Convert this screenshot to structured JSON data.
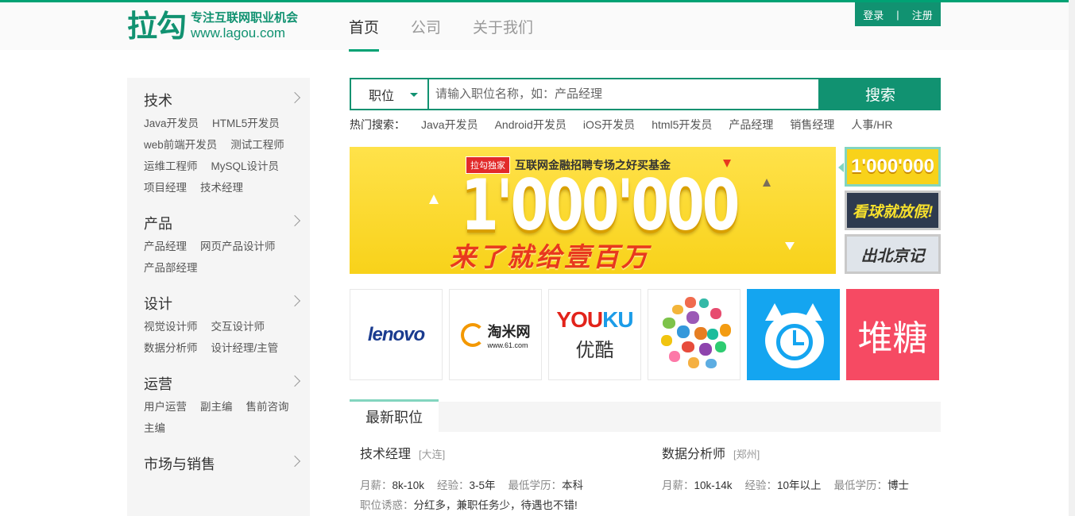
{
  "header": {
    "logo_text": "拉勾",
    "slogan": "专注互联网职业机会",
    "url": "www.lagou.com",
    "nav": [
      "首页",
      "公司",
      "关于我们"
    ],
    "login": "登录",
    "sep": "|",
    "register": "注册"
  },
  "sidebar": {
    "categories": [
      {
        "title": "技术",
        "links": [
          "Java开发员",
          "HTML5开发员",
          "web前端开发员",
          "测试工程师",
          "运维工程师",
          "MySQL设计员",
          "项目经理",
          "技术经理"
        ]
      },
      {
        "title": "产品",
        "links": [
          "产品经理",
          "网页产品设计师",
          "产品部经理"
        ]
      },
      {
        "title": "设计",
        "links": [
          "视觉设计师",
          "交互设计师",
          "数据分析师",
          "设计经理/主管"
        ]
      },
      {
        "title": "运营",
        "links": [
          "用户运营",
          "副主编",
          "售前咨询",
          "主编"
        ]
      },
      {
        "title": "市场与销售",
        "links": []
      }
    ]
  },
  "search": {
    "select_value": "职位",
    "placeholder": "请输入职位名称，如：产品经理",
    "button": "搜索",
    "hot_label": "热门搜索：",
    "hot_terms": [
      "Java开发员",
      "Android开发员",
      "iOS开发员",
      "html5开发员",
      "产品经理",
      "销售经理",
      "人事/HR"
    ]
  },
  "banner": {
    "tag": "拉勾独家",
    "headline": "互联网金融招聘专场之好买基金",
    "big_number": "1'000'000",
    "subtitle": "来了就给壹百万",
    "thumbs": [
      "1'000'000",
      "看球就放假!",
      "出北京记"
    ]
  },
  "brands": {
    "lenovo": "lenovo",
    "taomi_name": "淘米网",
    "taomi_url": "www.61.com",
    "youku_en_a": "YOU",
    "youku_en_b": "KU",
    "youku_cn": "优酷",
    "duitang": "堆糖"
  },
  "latest": {
    "tab": "最新职位",
    "jobs": [
      {
        "title": "技术经理",
        "city": "[大连]",
        "salary_k": "月薪：",
        "salary": "8k-10k",
        "exp_k": "经验：",
        "exp": "3-5年",
        "edu_k": "最低学历：",
        "edu": "本科",
        "perk_k": "职位诱惑：",
        "perk": "分红多，兼职任务少，待遇也不错!"
      },
      {
        "title": "数据分析师",
        "city": "[郑州]",
        "salary_k": "月薪：",
        "salary": "10k-14k",
        "exp_k": "经验：",
        "exp": "10年以上",
        "edu_k": "最低学历：",
        "edu": "博士",
        "perk_k": "",
        "perk": ""
      }
    ]
  },
  "colors": {
    "brand_green": "#119271",
    "accent_mint": "#83d5bf"
  }
}
